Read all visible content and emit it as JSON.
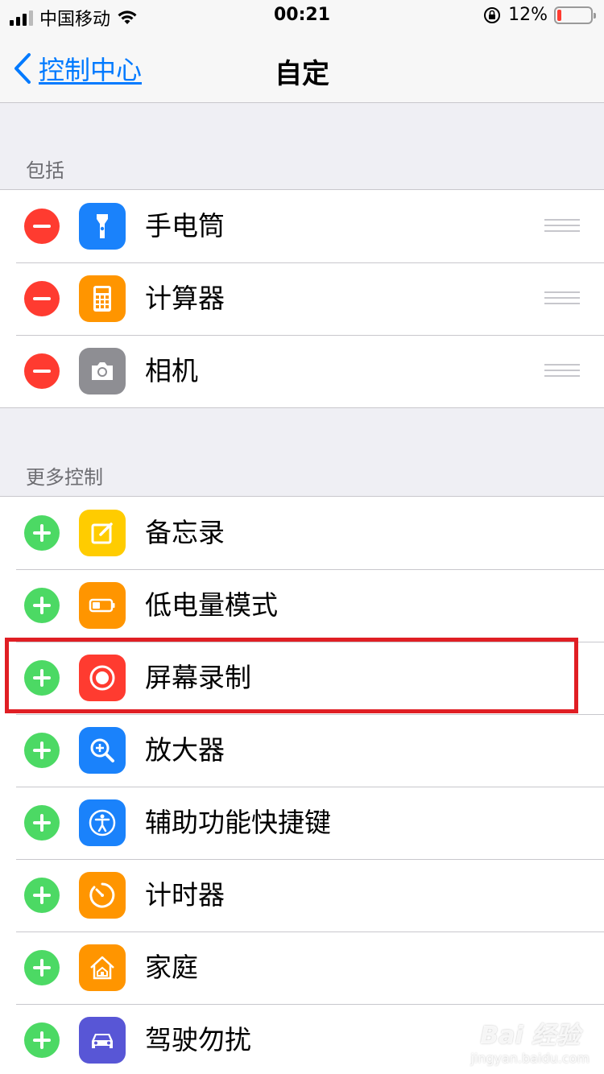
{
  "status_bar": {
    "carrier": "中国移动",
    "time": "00:21",
    "battery_percent": "12%",
    "signal_bars": 3,
    "battery_level": 0.12,
    "battery_color": "#ff3b30"
  },
  "nav": {
    "back_label": "控制中心",
    "title": "自定"
  },
  "included": {
    "header": "包括",
    "items": [
      {
        "label": "手电筒",
        "icon": "flashlight-icon",
        "color": "#1a82fb"
      },
      {
        "label": "计算器",
        "icon": "calculator-icon",
        "color": "#ff9500"
      },
      {
        "label": "相机",
        "icon": "camera-icon",
        "color": "#8e8e93"
      }
    ]
  },
  "more_controls": {
    "header": "更多控制",
    "items": [
      {
        "label": "备忘录",
        "icon": "notes-icon",
        "color": "#ffcc00"
      },
      {
        "label": "低电量模式",
        "icon": "low-power-icon",
        "color": "#ff9500"
      },
      {
        "label": "屏幕录制",
        "icon": "screen-record-icon",
        "color": "#ff3b30",
        "highlighted": true
      },
      {
        "label": "放大器",
        "icon": "magnifier-icon",
        "color": "#1a82fb"
      },
      {
        "label": "辅助功能快捷键",
        "icon": "accessibility-icon",
        "color": "#1a82fb"
      },
      {
        "label": "计时器",
        "icon": "timer-icon",
        "color": "#ff9500"
      },
      {
        "label": "家庭",
        "icon": "home-icon",
        "color": "#ff9500"
      },
      {
        "label": "驾驶勿扰",
        "icon": "car-icon",
        "color": "#5856d6"
      }
    ]
  },
  "watermark": {
    "main": "Bai 经验",
    "sub": "jingyan.baidu.com"
  },
  "colors": {
    "accent": "#007aff",
    "remove": "#ff3b30",
    "add": "#4cd964",
    "highlight_border": "#e01e24"
  }
}
